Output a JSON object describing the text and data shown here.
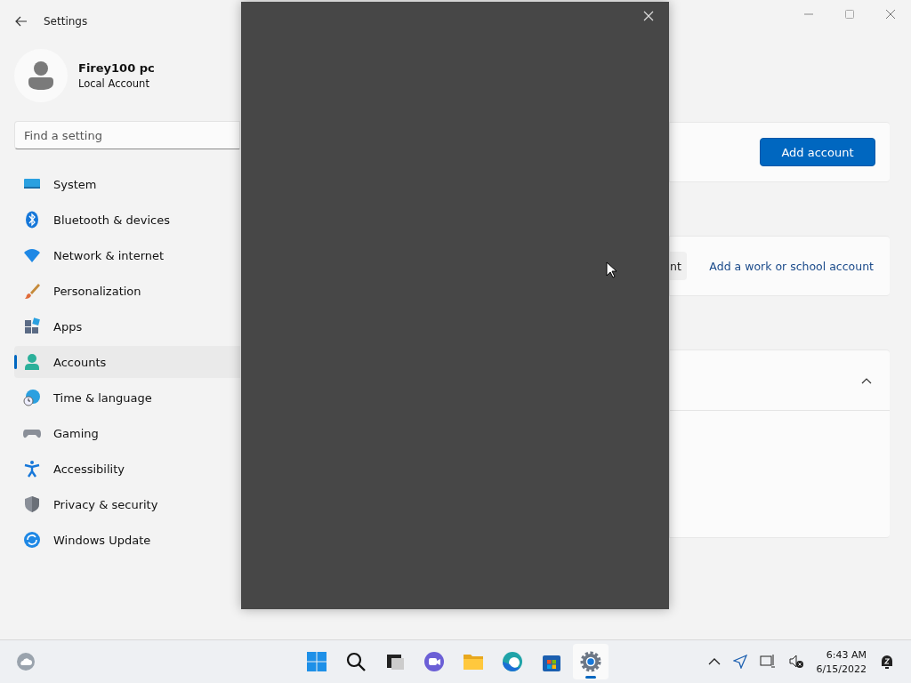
{
  "window": {
    "title": "Settings"
  },
  "profile": {
    "name": "Firey100 pc",
    "account_type": "Local Account"
  },
  "search": {
    "placeholder": "Find a setting"
  },
  "nav": [
    {
      "kind": "system",
      "label": "System",
      "selected": false
    },
    {
      "kind": "bluetooth",
      "label": "Bluetooth & devices",
      "selected": false
    },
    {
      "kind": "network",
      "label": "Network & internet",
      "selected": false
    },
    {
      "kind": "personalization",
      "label": "Personalization",
      "selected": false
    },
    {
      "kind": "apps",
      "label": "Apps",
      "selected": false
    },
    {
      "kind": "accounts",
      "label": "Accounts",
      "selected": true
    },
    {
      "kind": "time",
      "label": "Time & language",
      "selected": false
    },
    {
      "kind": "gaming",
      "label": "Gaming",
      "selected": false
    },
    {
      "kind": "accessibility",
      "label": "Accessibility",
      "selected": false
    },
    {
      "kind": "privacy",
      "label": "Privacy & security",
      "selected": false
    },
    {
      "kind": "update",
      "label": "Windows Update",
      "selected": false
    }
  ],
  "main": {
    "add_account_button": "Add account",
    "partial_button": "nt",
    "work_link": "Add a work or school account",
    "section_expanded": true
  },
  "taskbar": {
    "apps": [
      {
        "kind": "start",
        "selected": false
      },
      {
        "kind": "search",
        "selected": false
      },
      {
        "kind": "taskview",
        "selected": false
      },
      {
        "kind": "chat",
        "selected": false
      },
      {
        "kind": "explorer",
        "selected": false
      },
      {
        "kind": "edge",
        "selected": false
      },
      {
        "kind": "store",
        "selected": false
      },
      {
        "kind": "settings",
        "selected": true
      }
    ],
    "time": "6:43 AM",
    "date": "6/15/2022"
  }
}
